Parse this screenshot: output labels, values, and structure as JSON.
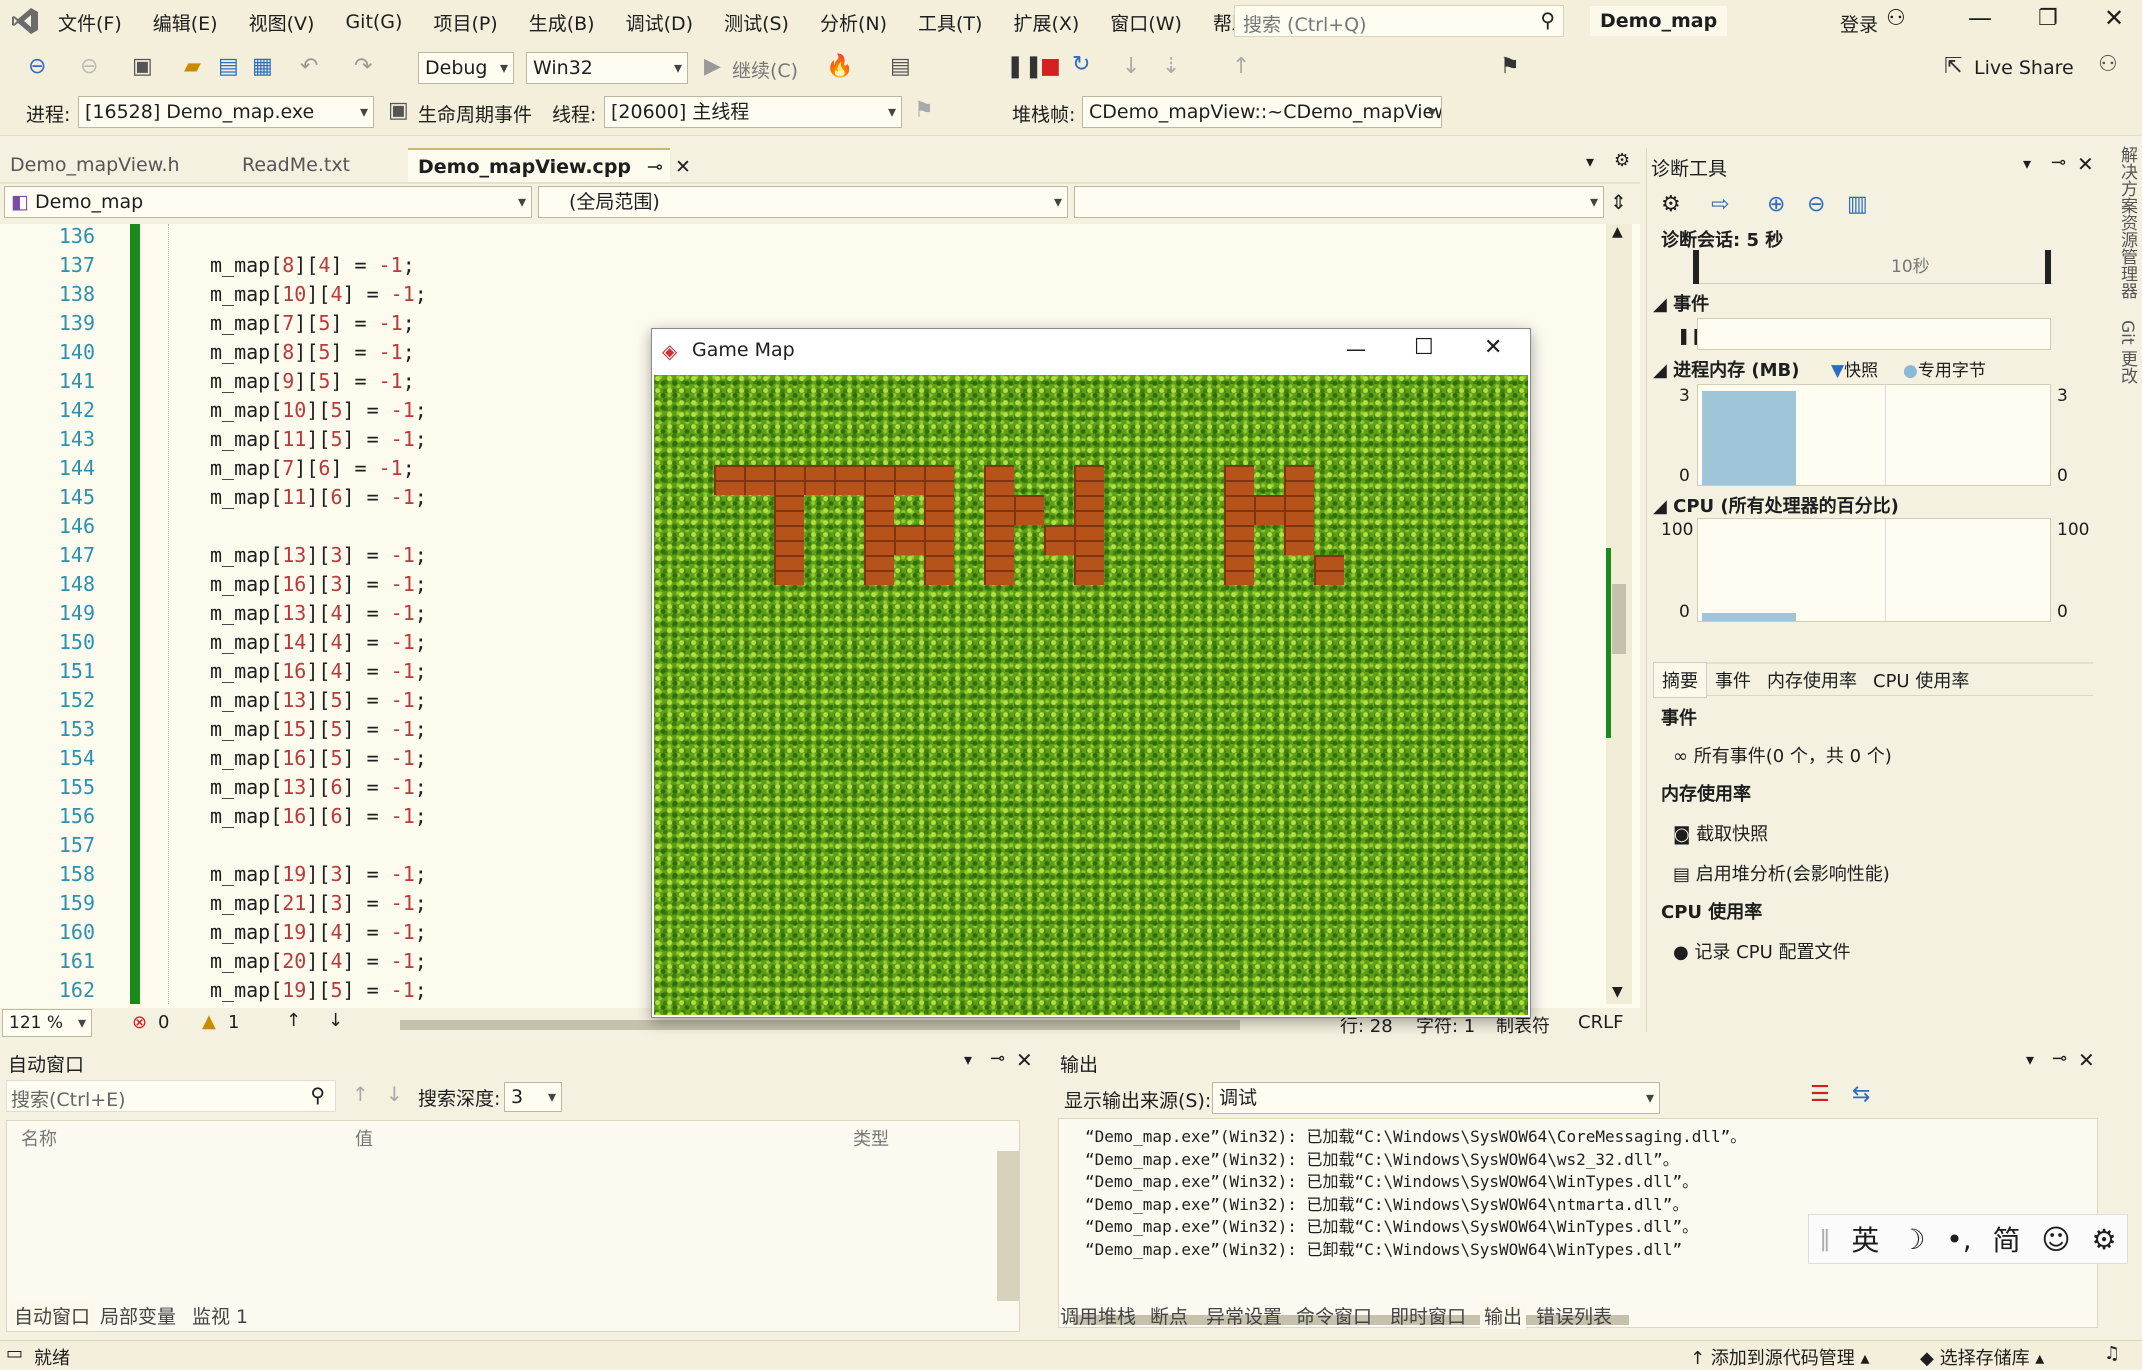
{
  "titlebar": {
    "menu": [
      "文件(F)",
      "编辑(E)",
      "视图(V)",
      "Git(G)",
      "项目(P)",
      "生成(B)",
      "调试(D)",
      "测试(S)",
      "分析(N)",
      "工具(T)",
      "扩展(X)",
      "窗口(W)",
      "帮助(H)"
    ],
    "search": "搜索 (Ctrl+Q)",
    "solution": "Demo_map",
    "login": "登录"
  },
  "toolbar1": {
    "config": "Debug",
    "platform": "Win32",
    "continue": "继续(C)",
    "live_share": "Live Share"
  },
  "toolbar2": {
    "process_label": "进程:",
    "process": "[16528] Demo_map.exe",
    "lifecycle": "生命周期事件",
    "thread_label": "线程:",
    "thread": "[20600] 主线程",
    "stack_label": "堆栈帧:",
    "stack": "CDemo_mapView::~CDemo_mapView"
  },
  "tabs": [
    "Demo_mapView.h",
    "ReadMe.txt",
    "Demo_mapView.cpp"
  ],
  "nav": {
    "project": "Demo_map",
    "scope": "(全局范围)",
    "member": ""
  },
  "code": {
    "lines": [
      "136",
      "137",
      "138",
      "139",
      "140",
      "141",
      "142",
      "143",
      "144",
      "145",
      "146",
      "147",
      "148",
      "149",
      "150",
      "151",
      "152",
      "153",
      "154",
      "155",
      "156",
      "157",
      "158",
      "159",
      "160",
      "161",
      "162"
    ],
    "text": [
      "",
      "m_map[8][4] = -1;",
      "m_map[10][4] = -1;",
      "m_map[7][5] = -1;",
      "m_map[8][5] = -1;",
      "m_map[9][5] = -1;",
      "m_map[10][5] = -1;",
      "m_map[11][5] = -1;",
      "m_map[7][6] = -1;",
      "m_map[11][6] = -1;",
      "",
      "m_map[13][3] = -1;",
      "m_map[16][3] = -1;",
      "m_map[13][4] = -1;",
      "m_map[14][4] = -1;",
      "m_map[16][4] = -1;",
      "m_map[13][5] = -1;",
      "m_map[15][5] = -1;",
      "m_map[16][5] = -1;",
      "m_map[13][6] = -1;",
      "m_map[16][6] = -1;",
      "",
      "m_map[19][3] = -1;",
      "m_map[21][3] = -1;",
      "m_map[19][4] = -1;",
      "m_map[20][4] = -1;",
      "m_map[19][5] = -1;"
    ]
  },
  "editor_status": {
    "zoom": "121 %",
    "errors": "0",
    "warnings": "1",
    "line": "行: 28",
    "char": "字符: 1",
    "tabs": "制表符",
    "crlf": "CRLF"
  },
  "game": {
    "title": "Game Map"
  },
  "diag": {
    "title": "诊断工具",
    "session": "诊断会话: 5 秒",
    "tick": "10秒",
    "events": "事件",
    "memory": "进程内存 (MB)",
    "snapshot": "快照",
    "private": "专用字节",
    "mem_max": "3",
    "mem_min": "0",
    "cpu": "CPU (所有处理器的百分比)",
    "cpu_max": "100",
    "cpu_min": "0",
    "tabs": [
      "摘要",
      "事件",
      "内存使用率",
      "CPU 使用率"
    ],
    "sec_events": "事件",
    "all_events": "所有事件(0 个，共 0 个)",
    "sec_mem": "内存使用率",
    "take_snapshot": "截取快照",
    "heap": "启用堆分析(会影响性能)",
    "sec_cpu": "CPU 使用率",
    "record_cpu": "记录 CPU 配置文件"
  },
  "autos": {
    "title": "自动窗口",
    "search": "搜索(Ctrl+E)",
    "depth_label": "搜索深度:",
    "depth": "3",
    "col_name": "名称",
    "col_value": "值",
    "col_type": "类型",
    "tabs": [
      "自动窗口",
      "局部变量",
      "监视 1"
    ]
  },
  "output": {
    "title": "输出",
    "source_label": "显示输出来源(S):",
    "source": "调试",
    "lines": [
      "“Demo_map.exe”(Win32): 已加载“C:\\Windows\\SysWOW64\\CoreMessaging.dll”。",
      "“Demo_map.exe”(Win32): 已加载“C:\\Windows\\SysWOW64\\ws2_32.dll”。",
      "“Demo_map.exe”(Win32): 已加载“C:\\Windows\\SysWOW64\\WinTypes.dll”。",
      "“Demo_map.exe”(Win32): 已加载“C:\\Windows\\SysWOW64\\ntmarta.dll”。",
      "“Demo_map.exe”(Win32): 已加载“C:\\Windows\\SysWOW64\\WinTypes.dll”。",
      "“Demo_map.exe”(Win32): 已卸载“C:\\Windows\\SysWOW64\\WinTypes.dll”"
    ],
    "tabs": [
      "调用堆栈",
      "断点",
      "异常设置",
      "命令窗口",
      "即时窗口",
      "输出",
      "错误列表"
    ]
  },
  "ime": {
    "lang": "英",
    "mode": "简"
  },
  "sidebar": [
    "解决方案资源管理器",
    "Git 更改"
  ],
  "status": {
    "ready": "就绪",
    "source_control": "添加到源代码管理",
    "repo": "选择存储库"
  }
}
